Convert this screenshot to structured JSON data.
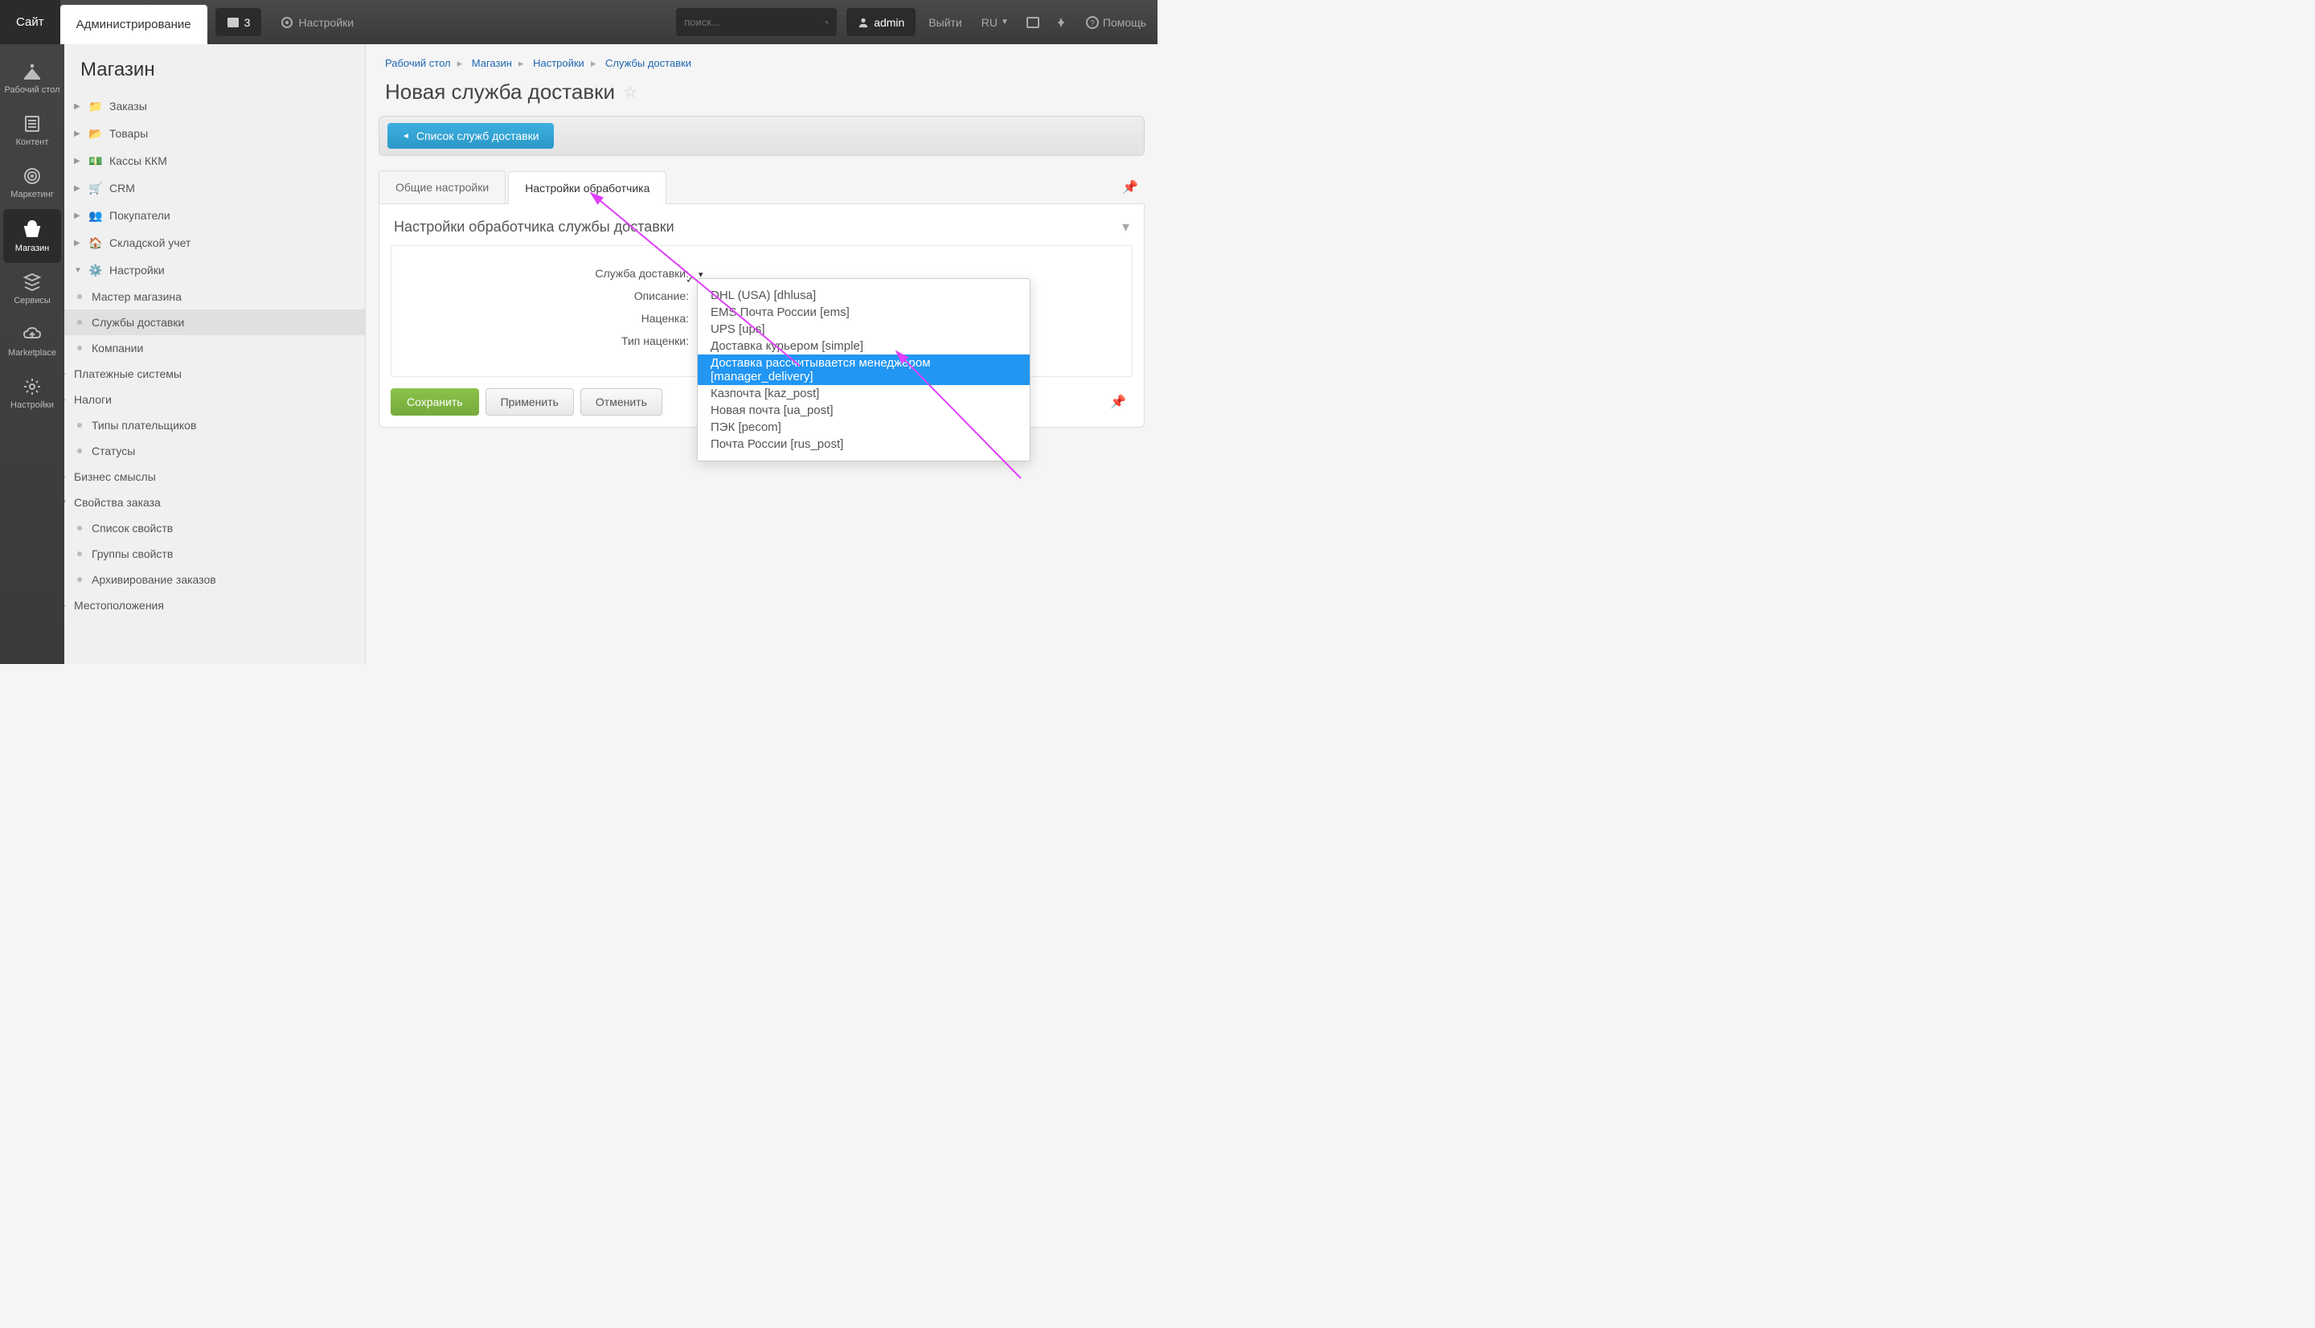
{
  "header": {
    "site_tab": "Сайт",
    "admin_tab": "Администрирование",
    "badge_count": "3",
    "settings": "Настройки",
    "search_placeholder": "поиск...",
    "user": "admin",
    "logout": "Выйти",
    "lang": "RU",
    "help": "Помощь"
  },
  "rail": [
    {
      "label": "Рабочий стол"
    },
    {
      "label": "Контент"
    },
    {
      "label": "Маркетинг"
    },
    {
      "label": "Магазин"
    },
    {
      "label": "Сервисы"
    },
    {
      "label": "Marketplace"
    },
    {
      "label": "Настройки"
    }
  ],
  "sidebar": {
    "title": "Магазин",
    "items": [
      {
        "label": "Заказы",
        "icon": "folder-icon"
      },
      {
        "label": "Товары",
        "icon": "folder2-icon"
      },
      {
        "label": "Кассы ККМ",
        "icon": "cash-icon"
      },
      {
        "label": "CRM",
        "icon": "crm-icon"
      },
      {
        "label": "Покупатели",
        "icon": "users-icon"
      },
      {
        "label": "Складской учет",
        "icon": "home-icon"
      },
      {
        "label": "Настройки",
        "icon": "gear-icon"
      }
    ],
    "settings_sub": [
      {
        "label": "Мастер магазина"
      },
      {
        "label": "Службы доставки"
      },
      {
        "label": "Компании"
      },
      {
        "label": "Платежные системы"
      },
      {
        "label": "Налоги"
      },
      {
        "label": "Типы плательщиков"
      },
      {
        "label": "Статусы"
      },
      {
        "label": "Бизнес смыслы"
      },
      {
        "label": "Свойства заказа"
      }
    ],
    "props_sub": [
      {
        "label": "Список свойств"
      },
      {
        "label": "Группы свойств"
      }
    ],
    "settings_sub2": [
      {
        "label": "Архивирование заказов"
      },
      {
        "label": "Местоположения"
      }
    ]
  },
  "breadcrumb": [
    "Рабочий стол",
    "Магазин",
    "Настройки",
    "Службы доставки"
  ],
  "page_title": "Новая служба доставки",
  "toolbar": {
    "list_btn": "Список служб доставки"
  },
  "tabs": [
    {
      "label": "Общие настройки"
    },
    {
      "label": "Настройки обработчика"
    }
  ],
  "panel": {
    "header": "Настройки обработчика службы доставки",
    "fields": {
      "service": "Служба доставки:",
      "description": "Описание:",
      "margin": "Наценка:",
      "margin_type": "Тип наценки:"
    }
  },
  "dropdown": {
    "options": [
      "DHL (USA) [dhlusa]",
      "EMS Почта России [ems]",
      "UPS [ups]",
      "Доставка курьером [simple]",
      "Доставка рассчитывается менеджером [manager_delivery]",
      "Казпочта [kaz_post]",
      "Новая почта [ua_post]",
      "ПЭК [pecom]",
      "Почта России [rus_post]"
    ]
  },
  "actions": {
    "save": "Сохранить",
    "apply": "Применить",
    "cancel": "Отменить"
  }
}
